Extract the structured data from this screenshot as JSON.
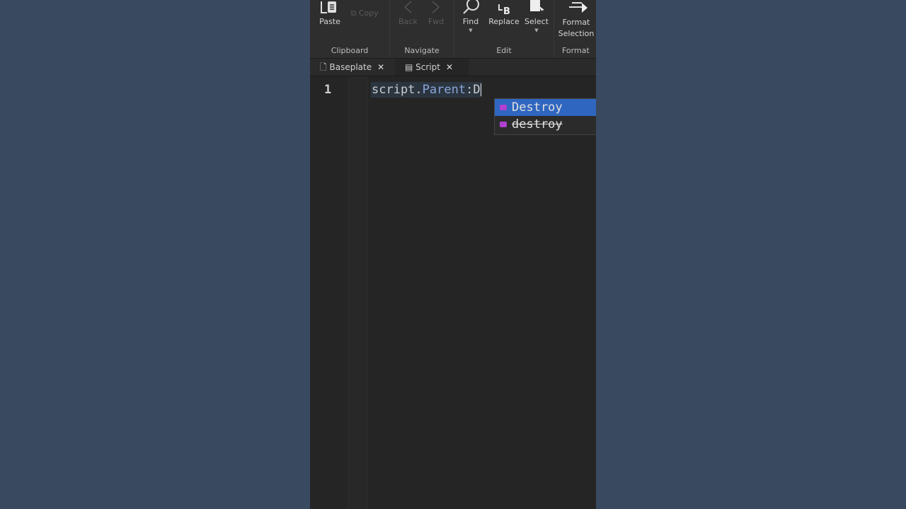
{
  "ribbon": {
    "groups": [
      {
        "label": "Clipboard",
        "buttons": [
          {
            "label": "Paste",
            "icon": "paste-icon"
          },
          {
            "label": "Copy",
            "icon": "copy-icon",
            "disabled": true
          }
        ]
      },
      {
        "label": "Navigate",
        "buttons": [
          {
            "label": "Back",
            "icon": "chevron-left-icon",
            "disabled": true
          },
          {
            "label": "Fwd",
            "icon": "chevron-right-icon",
            "disabled": true
          }
        ]
      },
      {
        "label": "Edit",
        "buttons": [
          {
            "label": "Find",
            "icon": "search-icon"
          },
          {
            "label": "Replace",
            "icon": "replace-icon"
          },
          {
            "label": "Select",
            "icon": "select-icon"
          }
        ]
      },
      {
        "label": "Format",
        "buttons": [
          {
            "label": "Format Selection",
            "icon": "format-icon"
          }
        ]
      }
    ]
  },
  "tabs": [
    {
      "label": "Baseplate",
      "icon": "place-file-icon"
    },
    {
      "label": "Script",
      "icon": "script-icon",
      "active": true
    }
  ],
  "editor": {
    "line_number": "1",
    "code_obj": "script",
    "code_dot": ".",
    "code_prop": "Parent",
    "code_rest": ":D"
  },
  "autocomplete": {
    "items": [
      {
        "label": "Destroy",
        "selected": true
      },
      {
        "label": "destroy",
        "deprecated": true
      }
    ]
  },
  "colors": {
    "background": "#394960",
    "selection": "#2f66c0",
    "method_icon": "#b040d0"
  }
}
